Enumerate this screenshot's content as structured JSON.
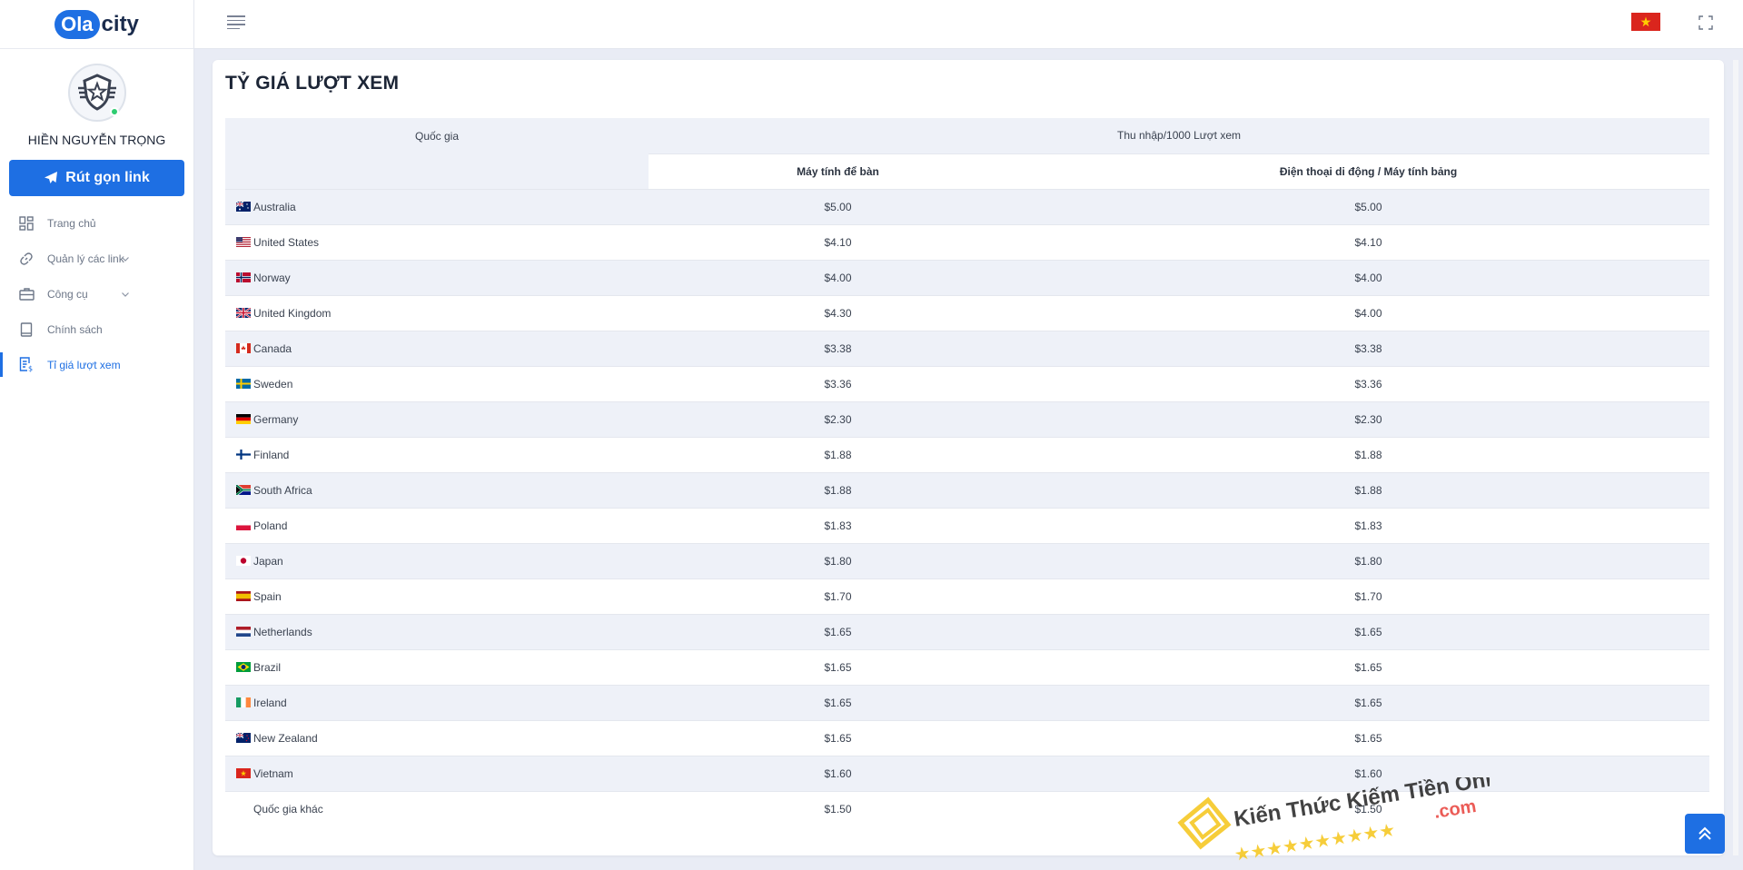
{
  "app": {
    "logo_part1": "Ola",
    "logo_part2": "city"
  },
  "sidebar": {
    "username": "HIỀN NGUYỄN TRỌNG",
    "shorten_button": "Rút gọn link",
    "items": [
      {
        "label": "Trang chủ",
        "icon": "dashboard-icon"
      },
      {
        "label": "Quản lý các link",
        "icon": "link-icon",
        "has_submenu": true
      },
      {
        "label": "Công cụ",
        "icon": "briefcase-icon",
        "has_submenu": true
      },
      {
        "label": "Chính sách",
        "icon": "document-icon"
      },
      {
        "label": "Tỉ giá lượt xem",
        "icon": "invoice-icon",
        "active": true
      }
    ]
  },
  "topbar": {
    "language_flag": "vietnam-flag-icon",
    "fullscreen_icon": "fullscreen-icon"
  },
  "page": {
    "title": "TỶ GIÁ LƯỢT XEM",
    "table": {
      "header_country": "Quốc gia",
      "header_income": "Thu nhập/1000 Lượt xem",
      "header_desktop": "Máy tính để bàn",
      "header_mobile": "Điện thoại di động / Máy tính bảng",
      "rows": [
        {
          "country": "Australia",
          "flag": "au",
          "desktop": "$5.00",
          "mobile": "$5.00"
        },
        {
          "country": "United States",
          "flag": "us",
          "desktop": "$4.10",
          "mobile": "$4.10"
        },
        {
          "country": "Norway",
          "flag": "no",
          "desktop": "$4.00",
          "mobile": "$4.00"
        },
        {
          "country": "United Kingdom",
          "flag": "gb",
          "desktop": "$4.30",
          "mobile": "$4.00"
        },
        {
          "country": "Canada",
          "flag": "ca",
          "desktop": "$3.38",
          "mobile": "$3.38"
        },
        {
          "country": "Sweden",
          "flag": "se",
          "desktop": "$3.36",
          "mobile": "$3.36"
        },
        {
          "country": "Germany",
          "flag": "de",
          "desktop": "$2.30",
          "mobile": "$2.30"
        },
        {
          "country": "Finland",
          "flag": "fi",
          "desktop": "$1.88",
          "mobile": "$1.88"
        },
        {
          "country": "South Africa",
          "flag": "za",
          "desktop": "$1.88",
          "mobile": "$1.88"
        },
        {
          "country": "Poland",
          "flag": "pl",
          "desktop": "$1.83",
          "mobile": "$1.83"
        },
        {
          "country": "Japan",
          "flag": "jp",
          "desktop": "$1.80",
          "mobile": "$1.80"
        },
        {
          "country": "Spain",
          "flag": "es",
          "desktop": "$1.70",
          "mobile": "$1.70"
        },
        {
          "country": "Netherlands",
          "flag": "nl",
          "desktop": "$1.65",
          "mobile": "$1.65"
        },
        {
          "country": "Brazil",
          "flag": "br",
          "desktop": "$1.65",
          "mobile": "$1.65"
        },
        {
          "country": "Ireland",
          "flag": "ie",
          "desktop": "$1.65",
          "mobile": "$1.65"
        },
        {
          "country": "New Zealand",
          "flag": "nz",
          "desktop": "$1.65",
          "mobile": "$1.65"
        },
        {
          "country": "Vietnam",
          "flag": "vn",
          "desktop": "$1.60",
          "mobile": "$1.60"
        },
        {
          "country": "Quốc gia khác",
          "flag": "",
          "desktop": "$1.50",
          "mobile": "$1.50"
        }
      ]
    }
  },
  "watermark": {
    "text": "Kiến Thức Kiếm Tiền Online",
    "suffix": ".com"
  },
  "colors": {
    "primary": "#1e6fe3",
    "row_alt": "#eef1f8",
    "online": "#2ecc71"
  }
}
